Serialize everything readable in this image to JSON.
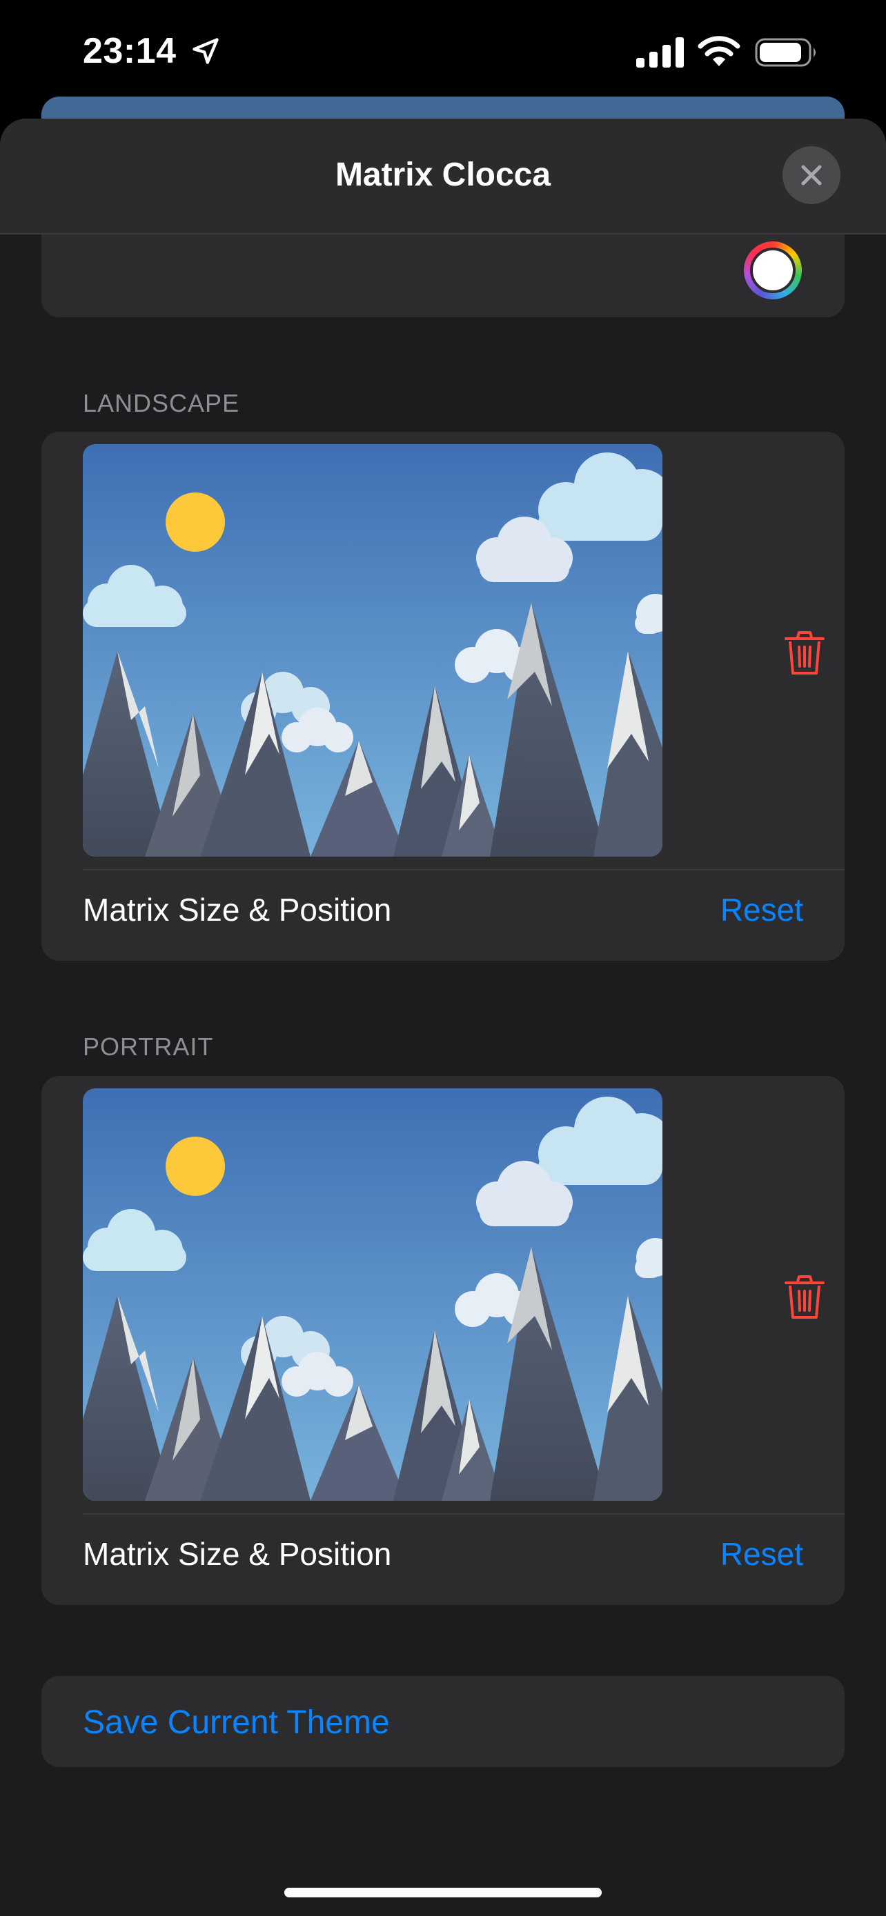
{
  "status_bar": {
    "time": "23:14",
    "location_icon": "location-arrow-icon",
    "signal_icon": "cellular-signal-icon",
    "wifi_icon": "wifi-icon",
    "battery_icon": "battery-icon"
  },
  "sheet": {
    "title": "Matrix Clocca",
    "close_icon": "close-icon"
  },
  "color_well": {
    "icon": "color-picker-icon",
    "selected_color": "#ffffff"
  },
  "landscape": {
    "header": "LANDSCAPE",
    "preview_icon": "background-image",
    "delete_icon": "trash-icon",
    "row_label": "Matrix Size & Position",
    "reset_label": "Reset"
  },
  "portrait": {
    "header": "PORTRAIT",
    "preview_icon": "background-image",
    "delete_icon": "trash-icon",
    "row_label": "Matrix Size & Position",
    "reset_label": "Reset"
  },
  "save_theme": {
    "label": "Save Current Theme"
  },
  "colors": {
    "accent": "#0a84ff",
    "destructive": "#ff453a",
    "sheet_background": "#1c1c1e",
    "card_background": "#2c2c2e",
    "secondary_text": "#8e8e93"
  }
}
